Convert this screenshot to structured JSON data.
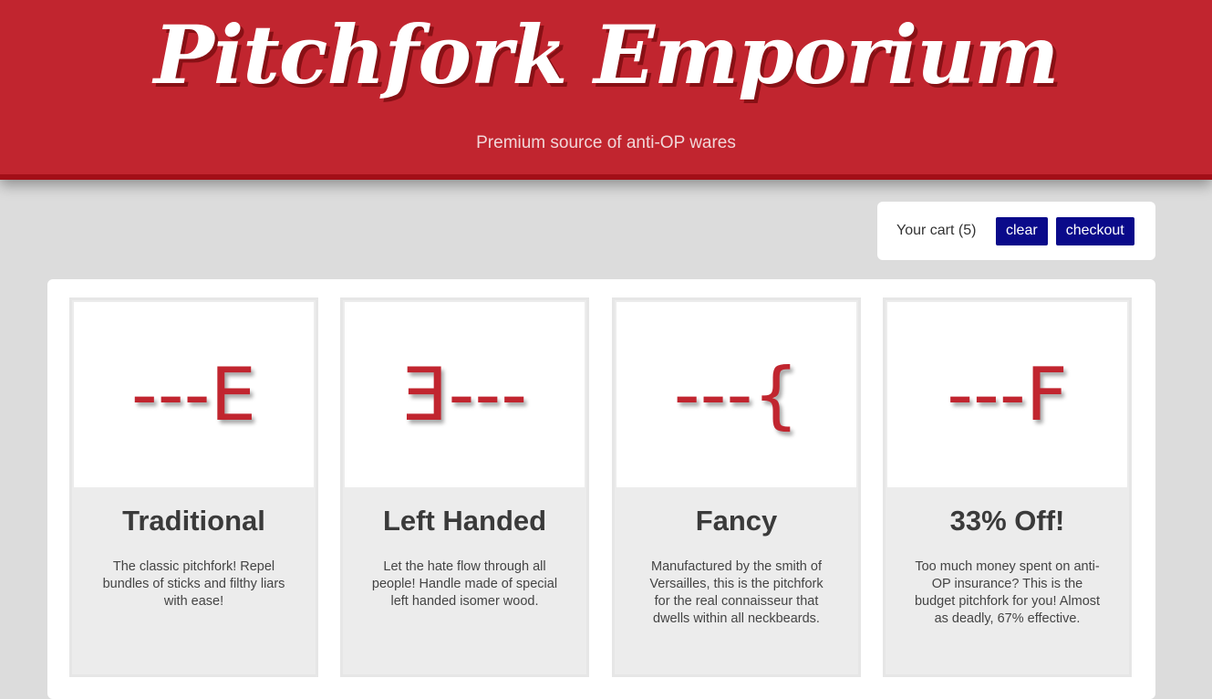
{
  "header": {
    "title": "Pitchfork Emporium",
    "tagline": "Premium source of anti-OP wares"
  },
  "cart": {
    "label": "Your cart (5)",
    "clear_label": "clear",
    "checkout_label": "checkout"
  },
  "products": [
    {
      "glyph": "---E",
      "title": "Traditional",
      "description": "The classic pitchfork! Repel bundles of sticks and filthy liars with ease!"
    },
    {
      "glyph": "Ǝ---",
      "title": "Left Handed",
      "description": "Let the hate flow through all people! Handle made of special left handed isomer wood."
    },
    {
      "glyph": "---{",
      "title": "Fancy",
      "description": "Manufactured by the smith of Versailles, this is the pitchfork for the real connaisseur that dwells within all neckbeards."
    },
    {
      "glyph": "---F",
      "title": "33% Off!",
      "description": "Too much money spent on anti-OP insurance? This is the budget pitchfork for you! Almost as deadly, 67% effective."
    }
  ],
  "colors": {
    "brand_red": "#c1252f",
    "button_navy": "#0a0a8a",
    "page_bg": "#dcdcdc"
  }
}
